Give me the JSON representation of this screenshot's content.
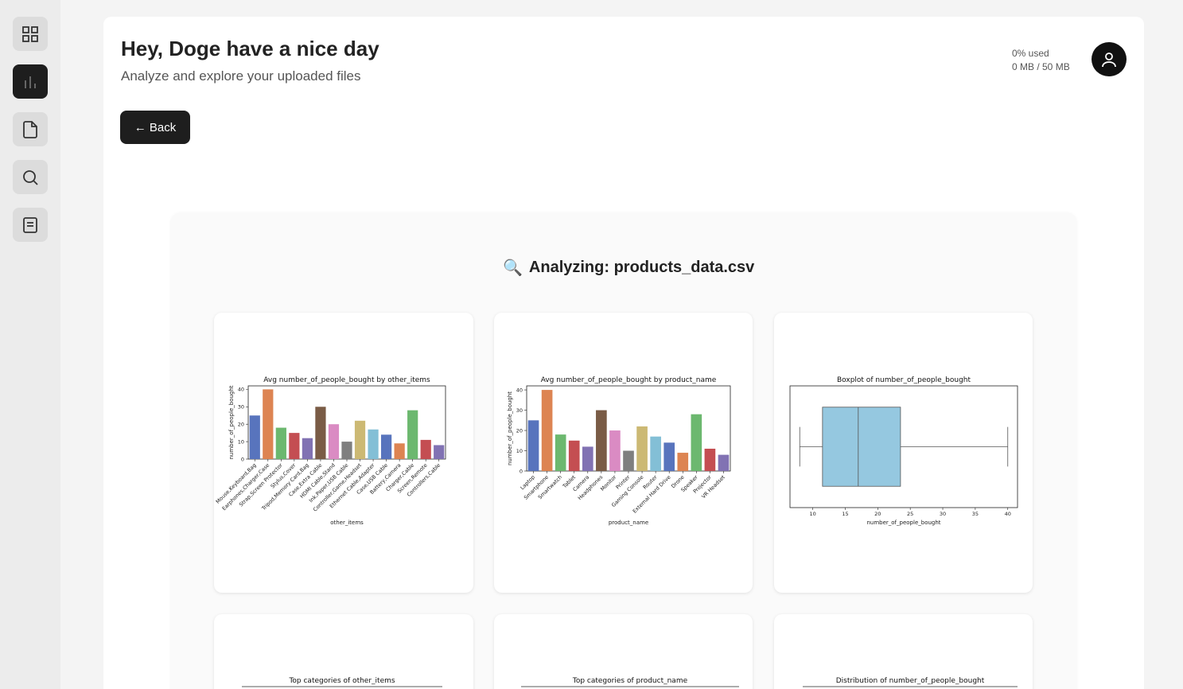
{
  "header": {
    "greeting": "Hey, Doge have a nice day",
    "subtitle": "Analyze and explore your uploaded files",
    "usage_percent": "0% used",
    "usage_size": "0 MB / 50 MB"
  },
  "sidebar": {
    "items": [
      {
        "icon": "grid-icon",
        "active": false
      },
      {
        "icon": "bar-chart-icon",
        "active": true
      },
      {
        "icon": "file-icon",
        "active": false
      },
      {
        "icon": "search-icon",
        "active": false
      },
      {
        "icon": "notes-icon",
        "active": false
      }
    ]
  },
  "actions": {
    "back_label": "← Back"
  },
  "analysis": {
    "title": "Analyzing: products_data.csv",
    "icon": "🔍"
  },
  "colors": [
    "#5874bd",
    "#dd8452",
    "#6cb86f",
    "#c44e52",
    "#8172b3",
    "#7a5c46",
    "#da8bc3",
    "#7f7f7f",
    "#ccb974",
    "#83bfd6"
  ],
  "chart_data": [
    {
      "type": "bar",
      "title": "Avg number_of_people_bought by other_items",
      "xlabel": "other_items",
      "ylabel": "number_of_people_bought",
      "ylim": [
        0,
        42
      ],
      "yticks": [
        0,
        10,
        20,
        30,
        40
      ],
      "categories": [
        "Mouse,Keyboard,Bag",
        "Earphones,Charger,Case",
        "Strap,Screen Protector",
        "Stylus,Cover",
        "Tripod,Memory Card,Bag",
        "Case,Extra Cable",
        "HDMI Cable,Stand",
        "Ink,Paper,USB Cable",
        "Controller,Game,Headset",
        "Ethernet Cable,Adapter",
        "Case,USB Cable",
        "Battery,Camera",
        "Charger,Cable",
        "Screen,Remote",
        "Controllers,Cable"
      ],
      "values": [
        25,
        40,
        18,
        15,
        12,
        30,
        20,
        10,
        22,
        17,
        14,
        9,
        28,
        11,
        8
      ]
    },
    {
      "type": "bar",
      "title": "Avg number_of_people_bought by product_name",
      "xlabel": "product_name",
      "ylabel": "number_of_people_bought",
      "ylim": [
        0,
        42
      ],
      "yticks": [
        0,
        10,
        20,
        30,
        40
      ],
      "categories": [
        "Laptop",
        "Smartphone",
        "Smartwatch",
        "Tablet",
        "Camera",
        "Headphones",
        "Monitor",
        "Printer",
        "Gaming Console",
        "Router",
        "External Hard Drive",
        "Drone",
        "Speaker",
        "Projector",
        "VR Headset"
      ],
      "values": [
        25,
        40,
        18,
        15,
        12,
        30,
        20,
        10,
        22,
        17,
        14,
        9,
        28,
        11,
        8
      ]
    },
    {
      "type": "boxplot",
      "title": "Boxplot of number_of_people_bought",
      "xlabel": "number_of_people_bought",
      "xlim": [
        6.5,
        41.5
      ],
      "xticks": [
        10,
        15,
        20,
        25,
        30,
        35,
        40
      ],
      "box": {
        "whisker_low": 8,
        "q1": 11.5,
        "median": 17,
        "q3": 23.5,
        "whisker_high": 40
      },
      "color": "#95c8e0"
    },
    {
      "type": "bar",
      "title": "Top categories of other_items"
    },
    {
      "type": "bar",
      "title": "Top categories of product_name"
    },
    {
      "type": "bar",
      "title": "Distribution of number_of_people_bought"
    }
  ]
}
